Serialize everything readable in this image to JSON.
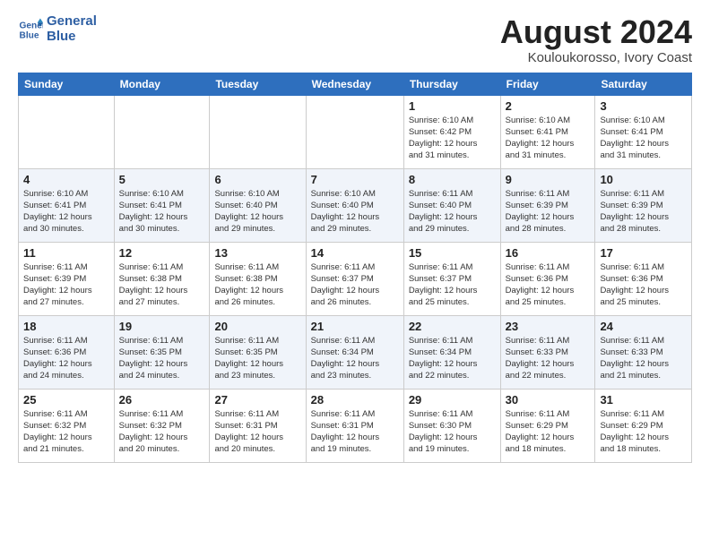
{
  "logo": {
    "line1": "General",
    "line2": "Blue"
  },
  "title": "August 2024",
  "subtitle": "Kouloukorosso, Ivory Coast",
  "days_header": [
    "Sunday",
    "Monday",
    "Tuesday",
    "Wednesday",
    "Thursday",
    "Friday",
    "Saturday"
  ],
  "weeks": [
    [
      {
        "day": "",
        "info": ""
      },
      {
        "day": "",
        "info": ""
      },
      {
        "day": "",
        "info": ""
      },
      {
        "day": "",
        "info": ""
      },
      {
        "day": "1",
        "info": "Sunrise: 6:10 AM\nSunset: 6:42 PM\nDaylight: 12 hours\nand 31 minutes."
      },
      {
        "day": "2",
        "info": "Sunrise: 6:10 AM\nSunset: 6:41 PM\nDaylight: 12 hours\nand 31 minutes."
      },
      {
        "day": "3",
        "info": "Sunrise: 6:10 AM\nSunset: 6:41 PM\nDaylight: 12 hours\nand 31 minutes."
      }
    ],
    [
      {
        "day": "4",
        "info": "Sunrise: 6:10 AM\nSunset: 6:41 PM\nDaylight: 12 hours\nand 30 minutes."
      },
      {
        "day": "5",
        "info": "Sunrise: 6:10 AM\nSunset: 6:41 PM\nDaylight: 12 hours\nand 30 minutes."
      },
      {
        "day": "6",
        "info": "Sunrise: 6:10 AM\nSunset: 6:40 PM\nDaylight: 12 hours\nand 29 minutes."
      },
      {
        "day": "7",
        "info": "Sunrise: 6:10 AM\nSunset: 6:40 PM\nDaylight: 12 hours\nand 29 minutes."
      },
      {
        "day": "8",
        "info": "Sunrise: 6:11 AM\nSunset: 6:40 PM\nDaylight: 12 hours\nand 29 minutes."
      },
      {
        "day": "9",
        "info": "Sunrise: 6:11 AM\nSunset: 6:39 PM\nDaylight: 12 hours\nand 28 minutes."
      },
      {
        "day": "10",
        "info": "Sunrise: 6:11 AM\nSunset: 6:39 PM\nDaylight: 12 hours\nand 28 minutes."
      }
    ],
    [
      {
        "day": "11",
        "info": "Sunrise: 6:11 AM\nSunset: 6:39 PM\nDaylight: 12 hours\nand 27 minutes."
      },
      {
        "day": "12",
        "info": "Sunrise: 6:11 AM\nSunset: 6:38 PM\nDaylight: 12 hours\nand 27 minutes."
      },
      {
        "day": "13",
        "info": "Sunrise: 6:11 AM\nSunset: 6:38 PM\nDaylight: 12 hours\nand 26 minutes."
      },
      {
        "day": "14",
        "info": "Sunrise: 6:11 AM\nSunset: 6:37 PM\nDaylight: 12 hours\nand 26 minutes."
      },
      {
        "day": "15",
        "info": "Sunrise: 6:11 AM\nSunset: 6:37 PM\nDaylight: 12 hours\nand 25 minutes."
      },
      {
        "day": "16",
        "info": "Sunrise: 6:11 AM\nSunset: 6:36 PM\nDaylight: 12 hours\nand 25 minutes."
      },
      {
        "day": "17",
        "info": "Sunrise: 6:11 AM\nSunset: 6:36 PM\nDaylight: 12 hours\nand 25 minutes."
      }
    ],
    [
      {
        "day": "18",
        "info": "Sunrise: 6:11 AM\nSunset: 6:36 PM\nDaylight: 12 hours\nand 24 minutes."
      },
      {
        "day": "19",
        "info": "Sunrise: 6:11 AM\nSunset: 6:35 PM\nDaylight: 12 hours\nand 24 minutes."
      },
      {
        "day": "20",
        "info": "Sunrise: 6:11 AM\nSunset: 6:35 PM\nDaylight: 12 hours\nand 23 minutes."
      },
      {
        "day": "21",
        "info": "Sunrise: 6:11 AM\nSunset: 6:34 PM\nDaylight: 12 hours\nand 23 minutes."
      },
      {
        "day": "22",
        "info": "Sunrise: 6:11 AM\nSunset: 6:34 PM\nDaylight: 12 hours\nand 22 minutes."
      },
      {
        "day": "23",
        "info": "Sunrise: 6:11 AM\nSunset: 6:33 PM\nDaylight: 12 hours\nand 22 minutes."
      },
      {
        "day": "24",
        "info": "Sunrise: 6:11 AM\nSunset: 6:33 PM\nDaylight: 12 hours\nand 21 minutes."
      }
    ],
    [
      {
        "day": "25",
        "info": "Sunrise: 6:11 AM\nSunset: 6:32 PM\nDaylight: 12 hours\nand 21 minutes."
      },
      {
        "day": "26",
        "info": "Sunrise: 6:11 AM\nSunset: 6:32 PM\nDaylight: 12 hours\nand 20 minutes."
      },
      {
        "day": "27",
        "info": "Sunrise: 6:11 AM\nSunset: 6:31 PM\nDaylight: 12 hours\nand 20 minutes."
      },
      {
        "day": "28",
        "info": "Sunrise: 6:11 AM\nSunset: 6:31 PM\nDaylight: 12 hours\nand 19 minutes."
      },
      {
        "day": "29",
        "info": "Sunrise: 6:11 AM\nSunset: 6:30 PM\nDaylight: 12 hours\nand 19 minutes."
      },
      {
        "day": "30",
        "info": "Sunrise: 6:11 AM\nSunset: 6:29 PM\nDaylight: 12 hours\nand 18 minutes."
      },
      {
        "day": "31",
        "info": "Sunrise: 6:11 AM\nSunset: 6:29 PM\nDaylight: 12 hours\nand 18 minutes."
      }
    ]
  ]
}
